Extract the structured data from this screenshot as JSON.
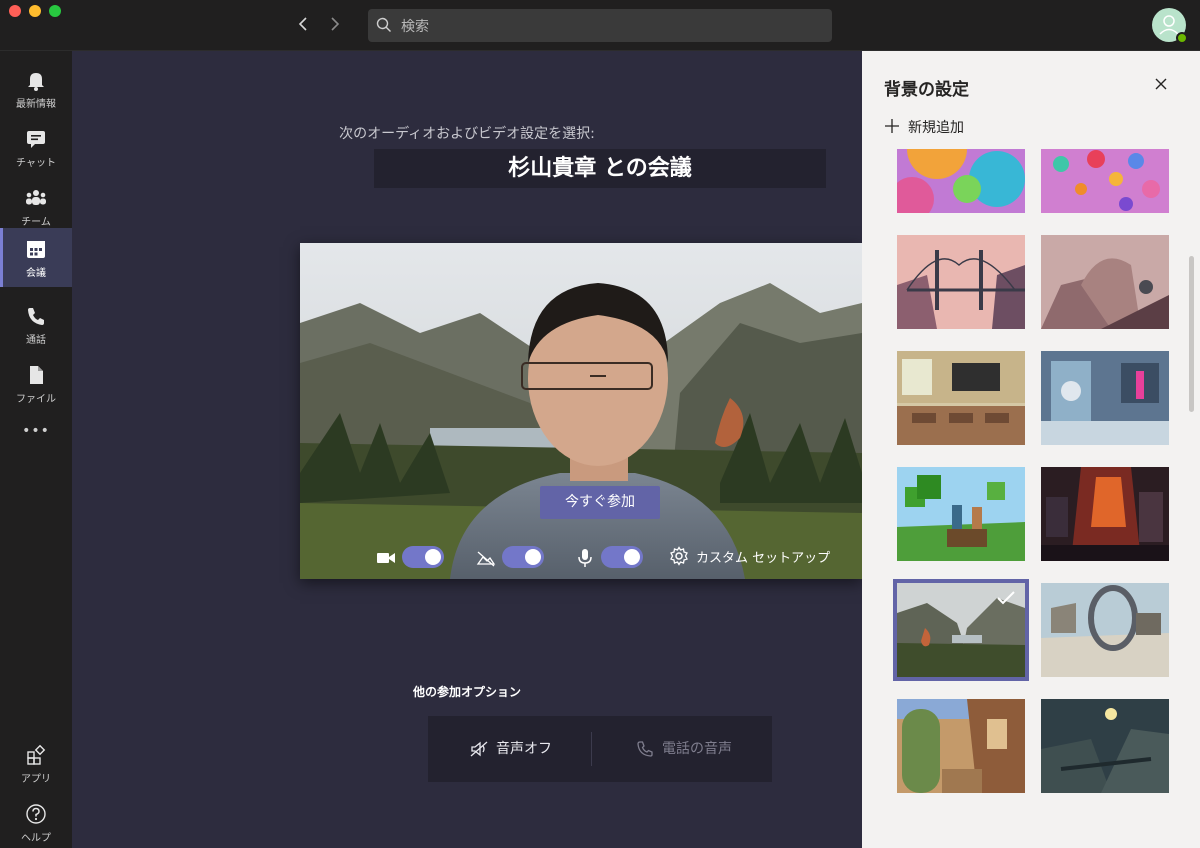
{
  "topbar": {
    "search_placeholder": "検索"
  },
  "rail": {
    "items": [
      {
        "label": "最新情報",
        "icon": "bell-icon"
      },
      {
        "label": "チャット",
        "icon": "chat-icon"
      },
      {
        "label": "チーム",
        "icon": "teams-icon"
      },
      {
        "label": "会議",
        "icon": "calendar-icon",
        "active": true
      },
      {
        "label": "通話",
        "icon": "phone-icon"
      },
      {
        "label": "ファイル",
        "icon": "file-icon"
      }
    ],
    "more": "•••",
    "bottom": [
      {
        "label": "アプリ",
        "icon": "apps-icon"
      },
      {
        "label": "ヘルプ",
        "icon": "help-icon"
      }
    ]
  },
  "main": {
    "subtitle": "次のオーディオおよびビデオ設定を選択:",
    "meeting_title": "杉山貴章 との会議",
    "join_button": "今すぐ参加",
    "controls": {
      "camera_on": true,
      "blur_on": true,
      "mic_on": true,
      "custom_setup": "カスタム セットアップ"
    },
    "other_options_title": "他の参加オプション",
    "audio_off": "音声オフ",
    "phone_audio": "電話の音声"
  },
  "panel": {
    "title": "背景の設定",
    "add_new": "新規追加",
    "selected_index": 8
  },
  "colors": {
    "accent": "#6264a7",
    "toggle": "#7377c9",
    "main_bg": "#2d2c3e",
    "panel_bg": "#f3f2f1"
  }
}
